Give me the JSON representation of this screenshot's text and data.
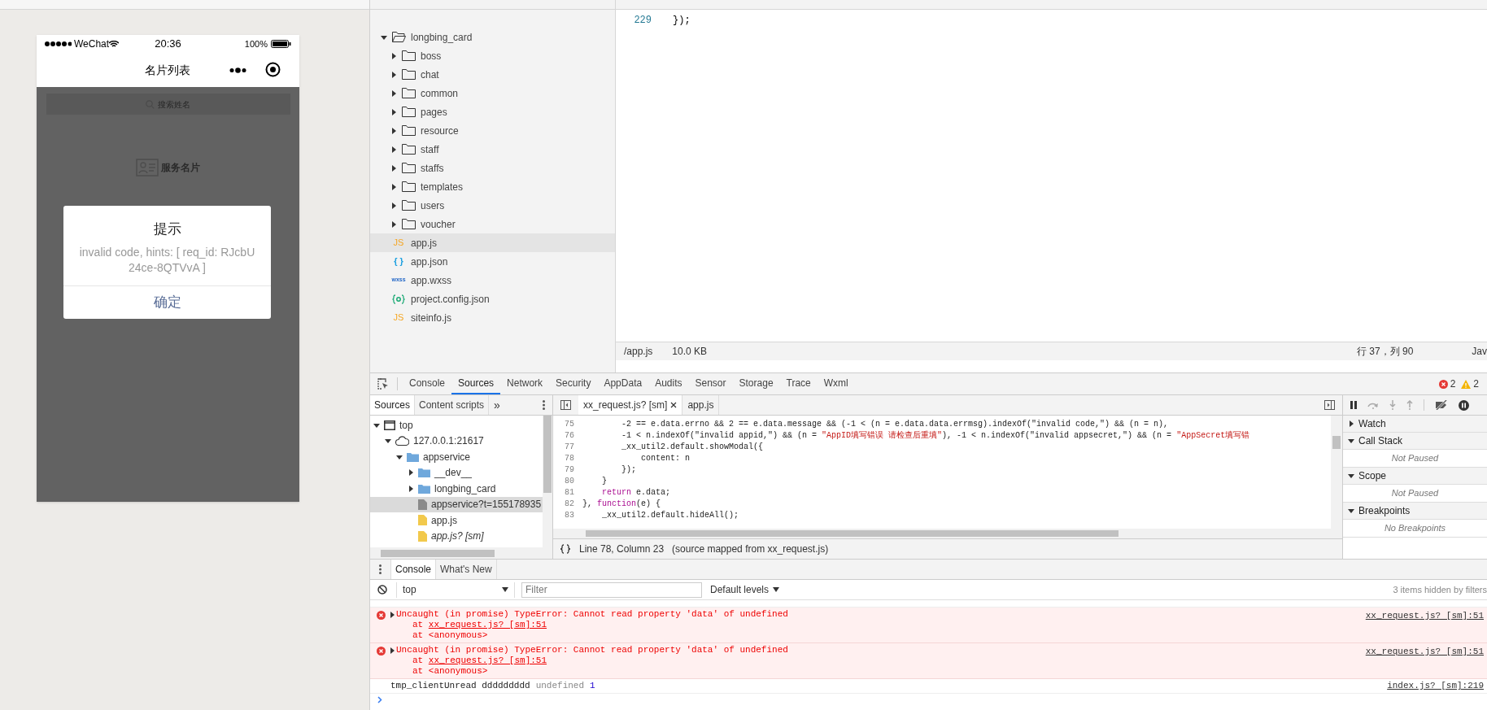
{
  "simulator": {
    "status_bar": {
      "carrier": "WeChat",
      "time": "20:36",
      "battery": "100%"
    },
    "nav_title": "名片列表",
    "search_placeholder": "搜索姓名",
    "empty_label": "服务名片",
    "modal": {
      "title": "提示",
      "message": "invalid code, hints: [ req_id: RJcbU24ce-8QTVvA ]",
      "button": "确定"
    }
  },
  "file_tree": {
    "label": "longbing_card",
    "expanded": true,
    "selected": false,
    "children": [
      {
        "label": "boss",
        "kind": "folder",
        "expanded": false,
        "selected": false
      },
      {
        "label": "chat",
        "kind": "folder",
        "expanded": false,
        "selected": false
      },
      {
        "label": "common",
        "kind": "folder",
        "expanded": false,
        "selected": false
      },
      {
        "label": "pages",
        "kind": "folder",
        "expanded": false,
        "selected": false
      },
      {
        "label": "resource",
        "kind": "folder",
        "expanded": false,
        "selected": false
      },
      {
        "label": "staff",
        "kind": "folder",
        "expanded": false,
        "selected": false
      },
      {
        "label": "staffs",
        "kind": "folder",
        "expanded": false,
        "selected": false
      },
      {
        "label": "templates",
        "kind": "folder",
        "expanded": false,
        "selected": false
      },
      {
        "label": "users",
        "kind": "folder",
        "expanded": false,
        "selected": false
      },
      {
        "label": "voucher",
        "kind": "folder",
        "expanded": false,
        "selected": false
      },
      {
        "label": "app.js",
        "kind": "js",
        "badge": "JS",
        "selected": true
      },
      {
        "label": "app.json",
        "kind": "json",
        "badge": "{ }",
        "selected": false
      },
      {
        "label": "app.wxss",
        "kind": "wxss",
        "badge": "wxss",
        "selected": false
      },
      {
        "label": "project.config.json",
        "kind": "config",
        "selected": false
      },
      {
        "label": "siteinfo.js",
        "kind": "js",
        "badge": "JS",
        "selected": false
      }
    ]
  },
  "editor": {
    "lines": [
      {
        "number": "229",
        "text": "});"
      }
    ],
    "status": {
      "path": "/app.js",
      "size": "10.0 KB",
      "position": "行 37，列 90",
      "language": "Jav"
    }
  },
  "devtools": {
    "tabs": [
      {
        "label": "Console",
        "selected": false
      },
      {
        "label": "Sources",
        "selected": true
      },
      {
        "label": "Network",
        "selected": false
      },
      {
        "label": "Security",
        "selected": false
      },
      {
        "label": "AppData",
        "selected": false
      },
      {
        "label": "Audits",
        "selected": false
      },
      {
        "label": "Sensor",
        "selected": false
      },
      {
        "label": "Storage",
        "selected": false
      },
      {
        "label": "Trace",
        "selected": false
      },
      {
        "label": "Wxml",
        "selected": false
      }
    ],
    "errors": "2",
    "warnings": "2",
    "sources": {
      "nav_tabs": [
        {
          "label": "Sources",
          "selected": true
        },
        {
          "label": "Content scripts",
          "selected": false
        }
      ],
      "more": "»",
      "tree": [
        {
          "label": "top",
          "kind": "frame",
          "expanded": true,
          "selected": false,
          "children": [
            {
              "label": "127.0.0.1:21617",
              "kind": "cloud",
              "expanded": true,
              "selected": false,
              "children": [
                {
                  "label": "appservice",
                  "kind": "folder",
                  "expanded": true,
                  "selected": false,
                  "children": [
                    {
                      "label": "__dev__",
                      "kind": "folder",
                      "expanded": false,
                      "selected": false
                    },
                    {
                      "label": "longbing_card",
                      "kind": "folder",
                      "expanded": false,
                      "selected": false
                    },
                    {
                      "label": "appservice?t=155178935",
                      "kind": "document",
                      "selected": true
                    },
                    {
                      "label": "app.js",
                      "kind": "script",
                      "selected": false
                    },
                    {
                      "label": "app.js? [sm]",
                      "kind": "mapped",
                      "selected": false
                    }
                  ]
                }
              ]
            }
          ]
        }
      ],
      "editor_tabs": [
        {
          "label": "xx_request.js? [sm]",
          "selected": true,
          "closable": true
        },
        {
          "label": "app.js",
          "selected": false,
          "closable": false
        }
      ],
      "code": [
        {
          "number": "75",
          "segments": [
            {
              "text": "        -2 == e.data.errno && 2 == e.data.message && (-1 < (n = e.data.data.errmsg).indexOf(\"invalid code,\") && (n = n),",
              "kind": "plain"
            }
          ]
        },
        {
          "number": "76",
          "segments": [
            {
              "text": "        -1 < n.indexOf(\"invalid appid,\") && (n = ",
              "kind": "plain"
            },
            {
              "text": "\"AppID填写错误 请检查后重填\"",
              "kind": "string"
            },
            {
              "text": "), -1 < n.indexOf(\"invalid appsecret,\") && (n = ",
              "kind": "plain"
            },
            {
              "text": "\"AppSecret填写错",
              "kind": "string"
            }
          ]
        },
        {
          "number": "77",
          "segments": [
            {
              "text": "        _xx_util2.default.showModal({",
              "kind": "plain"
            }
          ]
        },
        {
          "number": "78",
          "segments": [
            {
              "text": "            content: n",
              "kind": "plain"
            }
          ]
        },
        {
          "number": "79",
          "segments": [
            {
              "text": "        });",
              "kind": "plain"
            }
          ]
        },
        {
          "number": "80",
          "segments": [
            {
              "text": "    }",
              "kind": "plain"
            }
          ]
        },
        {
          "number": "81",
          "segments": [
            {
              "text": "    return",
              "kind": "keyword"
            },
            {
              "text": " e.data;",
              "kind": "plain"
            }
          ]
        },
        {
          "number": "82",
          "segments": [
            {
              "text": "}, ",
              "kind": "plain"
            },
            {
              "text": "function",
              "kind": "keyword"
            },
            {
              "text": "(e) {",
              "kind": "plain"
            }
          ]
        },
        {
          "number": "83",
          "segments": [
            {
              "text": "    _xx_util2.default.hideAll();",
              "kind": "plain"
            }
          ]
        }
      ],
      "status": "Line 78, Column 23",
      "source_note": "(source mapped from xx_request.js)"
    },
    "debugger": [
      {
        "label": "Watch",
        "expanded": false
      },
      {
        "label": "Call Stack",
        "expanded": true,
        "message": "Not Paused"
      },
      {
        "label": "Scope",
        "expanded": true,
        "message": "Not Paused"
      },
      {
        "label": "Breakpoints",
        "expanded": true,
        "message": "No Breakpoints"
      }
    ],
    "console": {
      "tabs": [
        {
          "label": "Console",
          "selected": true
        },
        {
          "label": "What's New",
          "selected": false
        }
      ],
      "context": "top",
      "filter_placeholder": "Filter",
      "levels": "Default levels",
      "hidden_note": "3 items hidden by filters",
      "messages": [
        {
          "kind": "error",
          "expanded": false,
          "text": "Uncaught (in promise) TypeError: Cannot read property 'data' of undefined",
          "stack": [
            {
              "text": "at ",
              "link": "xx_request.js? [sm]:51"
            },
            {
              "text": "at <anonymous>"
            }
          ],
          "source": "xx_request.js? [sm]:51"
        },
        {
          "kind": "error",
          "expanded": false,
          "text": "Uncaught (in promise) TypeError: Cannot read property 'data' of undefined",
          "stack": [
            {
              "text": "at ",
              "link": "xx_request.js? [sm]:51"
            },
            {
              "text": "at <anonymous>"
            }
          ],
          "source": "xx_request.js? [sm]:51"
        },
        {
          "kind": "log",
          "parts": [
            {
              "text": "tmp_clientUnread ddddddddd",
              "kind": "plain"
            },
            {
              "text": "undefined",
              "kind": "undefined"
            },
            {
              "text": "1",
              "kind": "number"
            }
          ],
          "source": "index.js? [sm]:219"
        }
      ]
    }
  }
}
